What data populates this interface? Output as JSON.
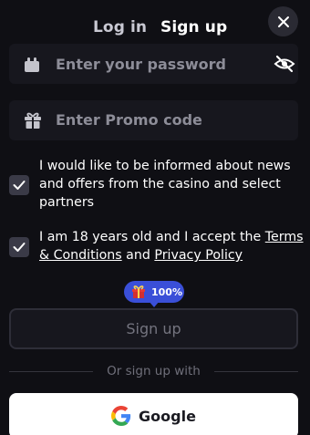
{
  "tabs": {
    "login": "Log in",
    "signup": "Sign up"
  },
  "icons": {
    "close": "close-icon",
    "lock": "lock-icon",
    "eye_off": "eye-off-icon",
    "gift": "gift-icon",
    "check": "check-icon",
    "google": "google-icon"
  },
  "form": {
    "password_placeholder": "Enter your password",
    "promo_placeholder": "Enter Promo code"
  },
  "consents": {
    "news": "I would like to be informed about news and offers from the casino and select partners",
    "age_prefix": "I am 18 years old and I accept the ",
    "terms_link": "Terms & Conditions",
    "age_and": " and ",
    "privacy_link": "Privacy Policy"
  },
  "bonus_badge": {
    "percent": "100%"
  },
  "actions": {
    "signup_button": "Sign up",
    "divider_text": "Or sign up with",
    "google_button": "Google"
  },
  "colors": {
    "background": "#0f0f14",
    "field": "#17171e",
    "accent": "#f3a328",
    "badge": "#3a4fd8"
  }
}
